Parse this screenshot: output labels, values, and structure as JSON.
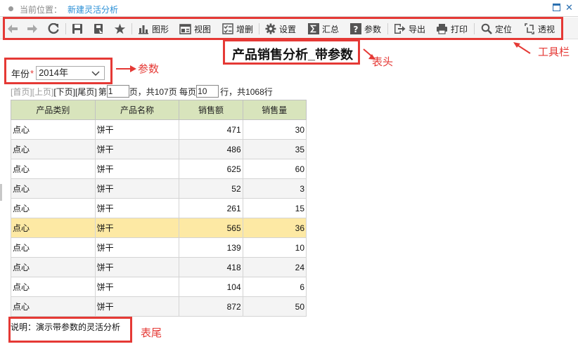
{
  "location": {
    "label": "当前位置：",
    "value": "新建灵活分析"
  },
  "toolbar": {
    "chart": "图形",
    "view": "视图",
    "edit": "增删",
    "settings": "设置",
    "summary": "汇总",
    "params": "参数",
    "export": "导出",
    "print": "打印",
    "locate": "定位",
    "pivot": "透视"
  },
  "report": {
    "title": "产品销售分析_带参数"
  },
  "param": {
    "label": "年份",
    "required_mark": "*",
    "selected": "2014年"
  },
  "pager": {
    "first": "[首页]",
    "prev": "[上页]",
    "next": "[下页]",
    "last": "[尾页]",
    "page_prefix": "第",
    "page_value": "1",
    "page_suffix": "页，共107页 每页",
    "per_page_value": "10",
    "per_page_suffix": "行，共1068行"
  },
  "table": {
    "headers": [
      "产品类别",
      "产品名称",
      "销售额",
      "销售量"
    ],
    "rows": [
      [
        "点心",
        "饼干",
        "471",
        "30"
      ],
      [
        "点心",
        "饼干",
        "486",
        "35"
      ],
      [
        "点心",
        "饼干",
        "625",
        "60"
      ],
      [
        "点心",
        "饼干",
        "52",
        "3"
      ],
      [
        "点心",
        "饼干",
        "261",
        "15"
      ],
      [
        "点心",
        "饼干",
        "565",
        "36"
      ],
      [
        "点心",
        "饼干",
        "139",
        "10"
      ],
      [
        "点心",
        "饼干",
        "418",
        "24"
      ],
      [
        "点心",
        "饼干",
        "104",
        "6"
      ],
      [
        "点心",
        "饼干",
        "872",
        "50"
      ]
    ],
    "selected_row_index": 5
  },
  "footer": {
    "note": "说明：演示带参数的灵活分析"
  },
  "annotations": {
    "toolbar": "工具栏",
    "header": "表头",
    "param": "参数",
    "footer": "表尾"
  },
  "colors": {
    "annotation": "#e53935",
    "header_bg": "#d8e4bc",
    "selected_row": "#fde9a4",
    "location_link": "#2a8fd6"
  }
}
